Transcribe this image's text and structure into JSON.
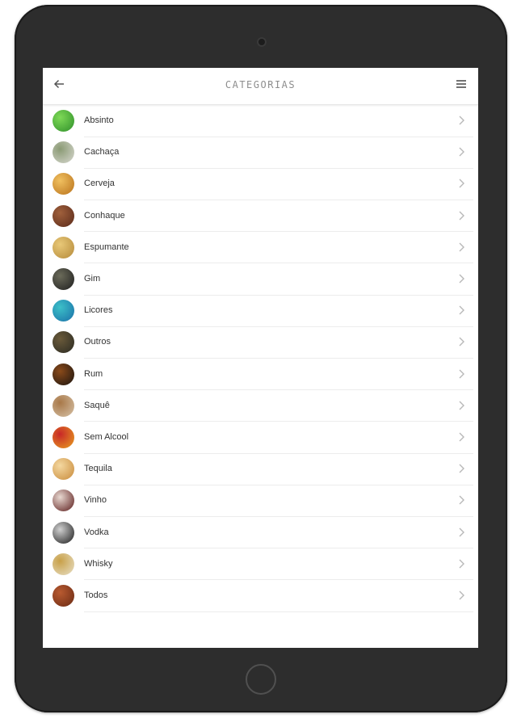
{
  "header": {
    "title": "CATEGORIAS",
    "back_icon": "arrow-left-icon",
    "menu_icon": "hamburger-menu-icon"
  },
  "categories": [
    {
      "label": "Absinto",
      "colors": [
        "#2f8f2a",
        "#7ed957"
      ]
    },
    {
      "label": "Cachaça",
      "colors": [
        "#d8d8d0",
        "#8a9a74"
      ]
    },
    {
      "label": "Cerveja",
      "colors": [
        "#b9721c",
        "#f0c060"
      ]
    },
    {
      "label": "Conhaque",
      "colors": [
        "#5a2a1a",
        "#a0603c"
      ]
    },
    {
      "label": "Espumante",
      "colors": [
        "#b58a3a",
        "#e8c878"
      ]
    },
    {
      "label": "Gim",
      "colors": [
        "#1e1e1e",
        "#6b6b5a"
      ]
    },
    {
      "label": "Licores",
      "colors": [
        "#1a6fa8",
        "#3cc0c8"
      ]
    },
    {
      "label": "Outros",
      "colors": [
        "#2a2a22",
        "#6a5a3a"
      ]
    },
    {
      "label": "Rum",
      "colors": [
        "#1a1410",
        "#8a4a1a"
      ]
    },
    {
      "label": "Saquê",
      "colors": [
        "#d6c2a8",
        "#a87848"
      ]
    },
    {
      "label": "Sem Alcool",
      "colors": [
        "#e8a020",
        "#c82828"
      ]
    },
    {
      "label": "Tequila",
      "colors": [
        "#c88a3a",
        "#f4d8a0"
      ]
    },
    {
      "label": "Vinho",
      "colors": [
        "#5a1a1a",
        "#e8d8d0"
      ]
    },
    {
      "label": "Vodka",
      "colors": [
        "#1a1a1a",
        "#d0d0d0"
      ]
    },
    {
      "label": "Whisky",
      "colors": [
        "#e8e0c8",
        "#c8a048"
      ]
    },
    {
      "label": "Todos",
      "colors": [
        "#6a2a14",
        "#b85a30"
      ]
    }
  ],
  "item_icon": "chevron-right-icon",
  "colors": {
    "background": "#ffffff",
    "device": "#2d2d2d",
    "title": "#8e8e8e",
    "text": "#333333"
  }
}
